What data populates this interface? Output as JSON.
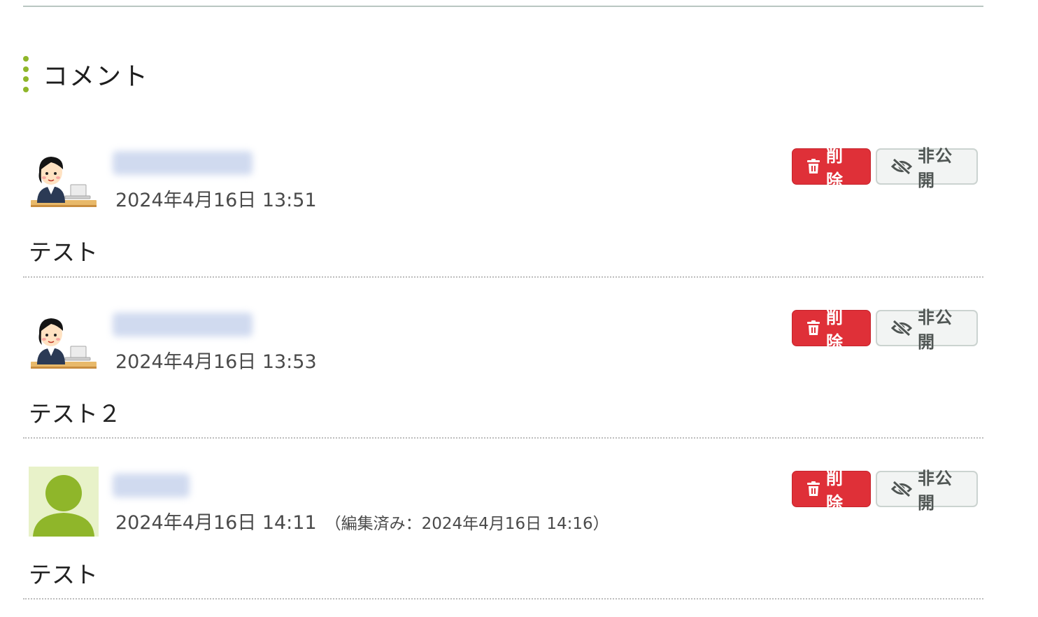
{
  "section": {
    "title": "コメント"
  },
  "comments": [
    {
      "date": "2024年4月16日 13:51",
      "edited": "",
      "body": "テスト",
      "avatar": "illustration-woman-laptop-icon",
      "delete_label": "削除",
      "hide_label": "非公開"
    },
    {
      "date": "2024年4月16日 13:53",
      "edited": "",
      "body": "テスト２",
      "avatar": "illustration-woman-laptop-icon",
      "delete_label": "削除",
      "hide_label": "非公開"
    },
    {
      "date": "2024年4月16日 14:11",
      "edited": "（編集済み：2024年4月16日 14:16）",
      "body": "テスト",
      "avatar": "default-user-icon",
      "delete_label": "削除",
      "hide_label": "非公開"
    }
  ],
  "colors": {
    "accent": "#8fb62a",
    "delete": "#df3038",
    "hide_bg": "#f2f4f3",
    "text": "#222222",
    "avatar_bg": "#e8f2c9"
  },
  "icons": {
    "delete": "trash-icon",
    "hide": "eye-slash-icon",
    "heading": "dotted-bar-icon"
  }
}
